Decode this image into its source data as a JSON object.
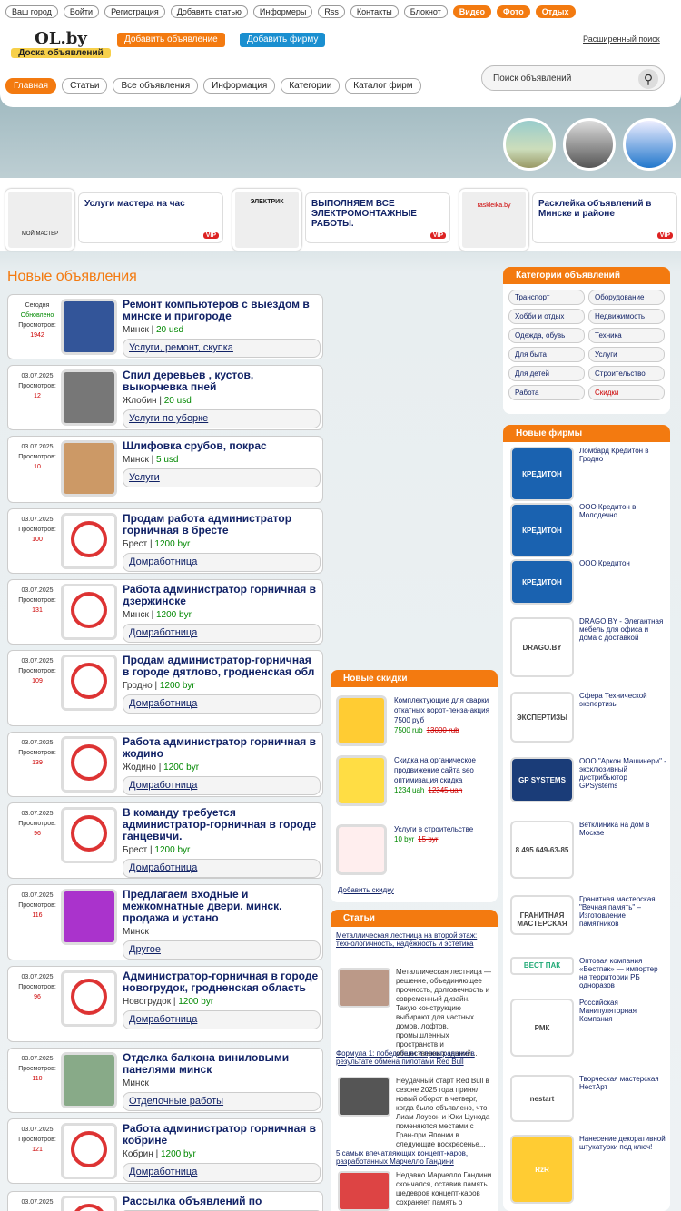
{
  "toplinks": [
    "Ваш город",
    "Войти",
    "Регистрация",
    "Добавить статью",
    "Информеры",
    "Rss",
    "Контакты",
    "Блокнот"
  ],
  "toplinks_orange": [
    "Видео",
    "Фото",
    "Отдых"
  ],
  "logo": {
    "name": "OL.by",
    "tagline": "Доска объявлений"
  },
  "buttons": {
    "add_ad": "Добавить объявление",
    "add_firm": "Добавить фирму"
  },
  "ext_search": "Расширенный поиск",
  "nav": [
    "Главная",
    "Статьи",
    "Все объявления",
    "Информация",
    "Категории",
    "Каталог фирм"
  ],
  "search": {
    "placeholder": "Поиск объявлений"
  },
  "vip": [
    {
      "text": "Услуги мастера на час",
      "tag": "VIP"
    },
    {
      "text": "ВЫПОЛНЯЕМ ВСЕ ЭЛЕКТРОМОНТАЖНЫЕ РАБОТЫ.",
      "tag": "VIP"
    },
    {
      "text": "Расклейка объявлений в Минске и районе",
      "tag": "VIP"
    }
  ],
  "vip_thumbs": [
    "МОЙ МАСТЕР",
    "ЭЛЕКТРИК",
    "raskleika.by"
  ],
  "section_title": "Новые объявления",
  "ads": [
    {
      "date": "Сегодня",
      "status": "Обновлено",
      "views_label": "Просмотров:",
      "views": "1942",
      "title": "Ремонт компьютеров с выездом в минске и пригороде",
      "city": "Минск",
      "price": "20 usd",
      "category": "Услуги, ремонт, скупка"
    },
    {
      "date": "03.07.2025",
      "views_label": "Просмотров:",
      "views": "12",
      "title": "Спил деревьев , кустов, выкорчевка пней",
      "city": "Жлобин",
      "price": "20 usd",
      "category": "Услуги по уборке"
    },
    {
      "date": "03.07.2025",
      "views_label": "Просмотров:",
      "views": "10",
      "title": "Шлифовка срубов, покрас",
      "city": "Минск",
      "price": "5 usd",
      "category": "Услуги"
    },
    {
      "date": "03.07.2025",
      "views_label": "Просмотров:",
      "views": "100",
      "title": "Продам работа администратор горничная в бресте",
      "city": "Брест",
      "price": "1200 byr",
      "category": "Домработница"
    },
    {
      "date": "03.07.2025",
      "views_label": "Просмотров:",
      "views": "131",
      "title": "Работа администратор горничная в дзержинске",
      "city": "Минск",
      "price": "1200 byr",
      "category": "Домработница"
    },
    {
      "date": "03.07.2025",
      "views_label": "Просмотров:",
      "views": "109",
      "title": "Продам администратор-горничная в городе дятлово, гродненская обл",
      "city": "Гродно",
      "price": "1200 byr",
      "category": "Домработница"
    },
    {
      "date": "03.07.2025",
      "views_label": "Просмотров:",
      "views": "139",
      "title": "Работа администратор горничная в жодино",
      "city": "Жодино",
      "price": "1200 byr",
      "category": "Домработница"
    },
    {
      "date": "03.07.2025",
      "views_label": "Просмотров:",
      "views": "96",
      "title": "В команду требуется администратор-горничная в городе ганцевичи.",
      "city": "Брест",
      "price": "1200 byr",
      "category": "Домработница"
    },
    {
      "date": "03.07.2025",
      "views_label": "Просмотров:",
      "views": "116",
      "title": "Предлагаем входные и межкомнатные двери. минск. продажа и устано",
      "city": "Минск",
      "price": "",
      "category": "Другое"
    },
    {
      "date": "03.07.2025",
      "views_label": "Просмотров:",
      "views": "96",
      "title": "Администратор-горничная в городе новогрудок, гродненская область",
      "city": "Новогрудок",
      "price": "1200 byr",
      "category": "Домработница"
    },
    {
      "date": "03.07.2025",
      "views_label": "Просмотров:",
      "views": "110",
      "title": "Отделка балкона виниловыми панелями минск",
      "city": "Минск",
      "price": "",
      "category": "Отделочные работы"
    },
    {
      "date": "03.07.2025",
      "views_label": "Просмотров:",
      "views": "121",
      "title": "Работа администратор горничная в кобрине",
      "city": "Кобрин",
      "price": "1200 byr",
      "category": "Домработница"
    },
    {
      "date": "03.07.2025",
      "views_label": "",
      "views": "",
      "title": "Рассылка объявлений по",
      "city": "",
      "price": "",
      "category": ""
    }
  ],
  "cats_title": "Категории объявлений",
  "cats": [
    "Транспорт",
    "Оборудование",
    "Хобби и отдых",
    "Недвижимость",
    "Одежда, обувь",
    "Техника",
    "Для быта",
    "Услуги",
    "Для детей",
    "Строительство",
    "Работа",
    "Скидки"
  ],
  "firms_title": "Новые фирмы",
  "firms": [
    "Ломбард Кредитон в Гродно",
    "ООО Кредитон в Молодечно",
    "ООО Кредитон",
    "DRAGO.BY - Элегантная мебель для офиса и дома с доставкой",
    "Сфера Технической экспертизы",
    "ООО \"Аркон Машинери\" - эксклюзивный дистрибьютор GPSystems",
    "Ветклиника на дом в Москве",
    "Гранитная мастерская \"Вечная память\" – Изготовление памятников",
    "Оптовая компания «Вестпак» — импортер на территории РБ одноразов",
    "Российская Манипуляторная Компания",
    "Творческая мастерская НестАрт",
    "Нанесение декоративной штукатурки под ключ!"
  ],
  "firm_logos": [
    "КРЕДИТОН",
    "КРЕДИТОН",
    "КРЕДИТОН",
    "DRAGO.BY",
    "ЭКСПЕРТИЗЫ",
    "GP SYSTEMS",
    "8 495 649-63-85",
    "ГРАНИТНАЯ МАСТЕРСКАЯ",
    "ВЕСТ ПАК",
    "РМК",
    "nestart",
    "RzR"
  ],
  "disc_title": "Новые скидки",
  "discounts": [
    {
      "title": "Комплектующие для сварки откатных ворот-пенза-акция 7500 руб",
      "price": "7500 rub",
      "old": "13000 rub"
    },
    {
      "title": "Скидка на органическое продвижение сайта seo оптимизация скидка",
      "price": "1234 uah",
      "old": "12345 uah"
    },
    {
      "title": "Услуги в строительстве",
      "price": "10 byr",
      "old": "15 byr"
    }
  ],
  "add_discount": "Добавить скидку",
  "art_title": "Статьи",
  "articles": [
    {
      "title": "Металлическая лестница на второй этаж: технологичность, надёжность и эстетика",
      "body": "Металлическая лестница — решение, объединяющее прочность, долговечность и современный дизайн. Такую конструкцию выбирают для частных домов, лофтов, промышленных пространств и общественных зданий..."
    },
    {
      "title": "Формула 1: победители и проигравшие в результате обмена пилотами Red Bull",
      "body": "Неудачный старт Red Bull в сезоне 2025 года принял новый оборот в четверг, когда было объявлено, что Лиам Лоусон и Юки Цунода поменяются местами с Гран-при Японии в следующие воскресенье..."
    },
    {
      "title": "5 самых впечатляющих концепт-каров, разработанных Марчелло Гандини",
      "body": "Недавно Марчелло Гандини скончался, оставив память шедевров концепт-каров сохраняет память о"
    }
  ]
}
